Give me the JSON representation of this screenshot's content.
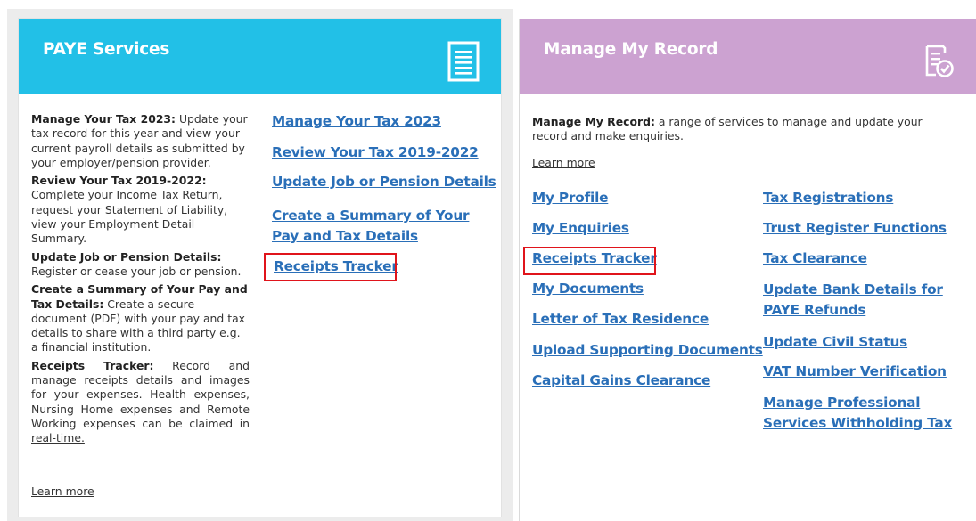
{
  "paye": {
    "title": "PAYE Services",
    "icon": "document-list-icon",
    "descriptions": [
      {
        "bold": "Manage Your Tax 2023:",
        "text": " Update your tax record for this year and view your current payroll details as submitted by your employer/pension provider."
      },
      {
        "bold": "Review Your Tax 2019-2022:",
        "text": " Complete your Income Tax Return, request your Statement of Liability, view your Employment Detail Summary."
      },
      {
        "bold": "Update Job or Pension Details:",
        "text": " Register or cease your job or pension."
      },
      {
        "bold": "Create a Summary of Your Pay and Tax Details:",
        "text": " Create a secure document (PDF) with your pay and tax details to share with a third party e.g. a financial institution."
      },
      {
        "bold": "Receipts Tracker:",
        "text": " Record and manage receipts details and images for your expenses. Health expenses, Nursing Home expenses and Remote Working expenses can be claimed in ",
        "link": "real-time."
      }
    ],
    "learn_more": "Learn more",
    "links": [
      "Manage Your Tax 2023",
      "Review Your Tax 2019-2022",
      "Update Job or Pension Details",
      "Create a Summary of Your Pay and Tax Details",
      "Receipts Tracker"
    ]
  },
  "mmr": {
    "title": "Manage My Record",
    "icon": "document-check-icon",
    "description_bold": "Manage My Record:",
    "description_text": " a range of services to manage and update your record and make enquiries.",
    "learn_more": "Learn more",
    "links_left": [
      "My Profile",
      "My Enquiries",
      "Receipts Tracker",
      "My Documents",
      "Letter of Tax Residence",
      "Upload Supporting Documents",
      "Capital Gains Clearance"
    ],
    "links_right": [
      "Tax Registrations",
      "Trust Register Functions",
      "Tax Clearance",
      "Update Bank Details for PAYE Refunds",
      "Update Civil Status",
      "VAT Number Verification",
      "Manage Professional Services Withholding Tax"
    ]
  },
  "colors": {
    "paye_header": "#22c0e7",
    "mmr_header": "#cca2d1",
    "link": "#2a6fb8",
    "highlight": "#e0141b"
  }
}
